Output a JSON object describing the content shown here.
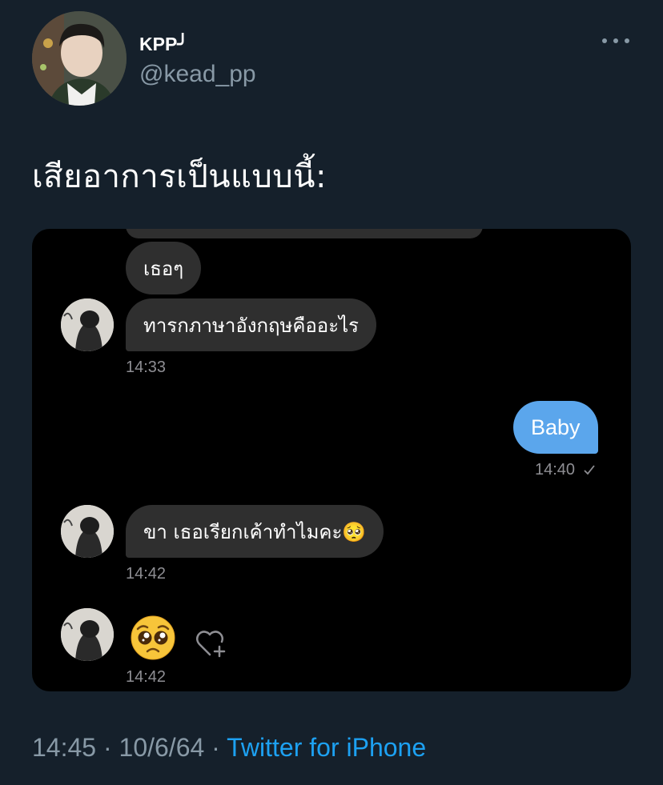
{
  "tweet": {
    "display_name": "KPP╯",
    "handle": "@kead_pp",
    "text": "เสียอาการเป็นแบบนี้:",
    "time": "14:45",
    "date": "10/6/64",
    "separator": "·",
    "source": "Twitter for iPhone"
  },
  "chat": {
    "messages": [
      {
        "sender": "other",
        "text": "เธอๆ"
      },
      {
        "sender": "other",
        "text": "ทารกภาษาอังกฤษคืออะไร",
        "time": "14:33"
      },
      {
        "sender": "me",
        "text": "Baby",
        "time": "14:40",
        "status_icon": "check-icon"
      },
      {
        "sender": "other",
        "text": "ขา เธอเรียกเค้าทำไมคะ🥺",
        "time": "14:42"
      },
      {
        "sender": "other",
        "emoji": "pleading-face-emoji",
        "time": "14:42"
      }
    ]
  },
  "icons": {
    "more": "more-horizontal-icon",
    "heart": "heart-add-icon",
    "check": "check-icon"
  },
  "colors": {
    "background": "#15202b",
    "media_background": "#000000",
    "incoming_bubble": "#2f2f2f",
    "outgoing_bubble": "#5ba6ec",
    "secondary_text": "#8899a6",
    "link": "#1da1f2"
  }
}
